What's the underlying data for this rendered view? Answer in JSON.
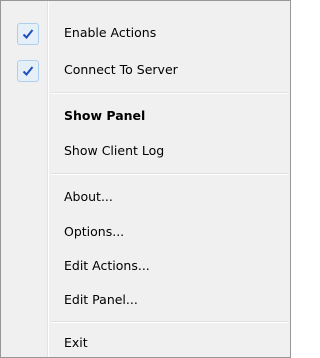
{
  "menu": {
    "items": [
      {
        "label": "Enable Actions",
        "checked": true
      },
      {
        "label": "Connect To Server",
        "checked": true
      },
      {
        "label": "Show Panel",
        "bold": true
      },
      {
        "label": "Show Client Log"
      },
      {
        "label": "About..."
      },
      {
        "label": "Options..."
      },
      {
        "label": "Edit Actions..."
      },
      {
        "label": "Edit Panel..."
      },
      {
        "label": "Exit"
      }
    ],
    "check_color": "#1f4fbf",
    "check_bg": "#e5eff8"
  }
}
